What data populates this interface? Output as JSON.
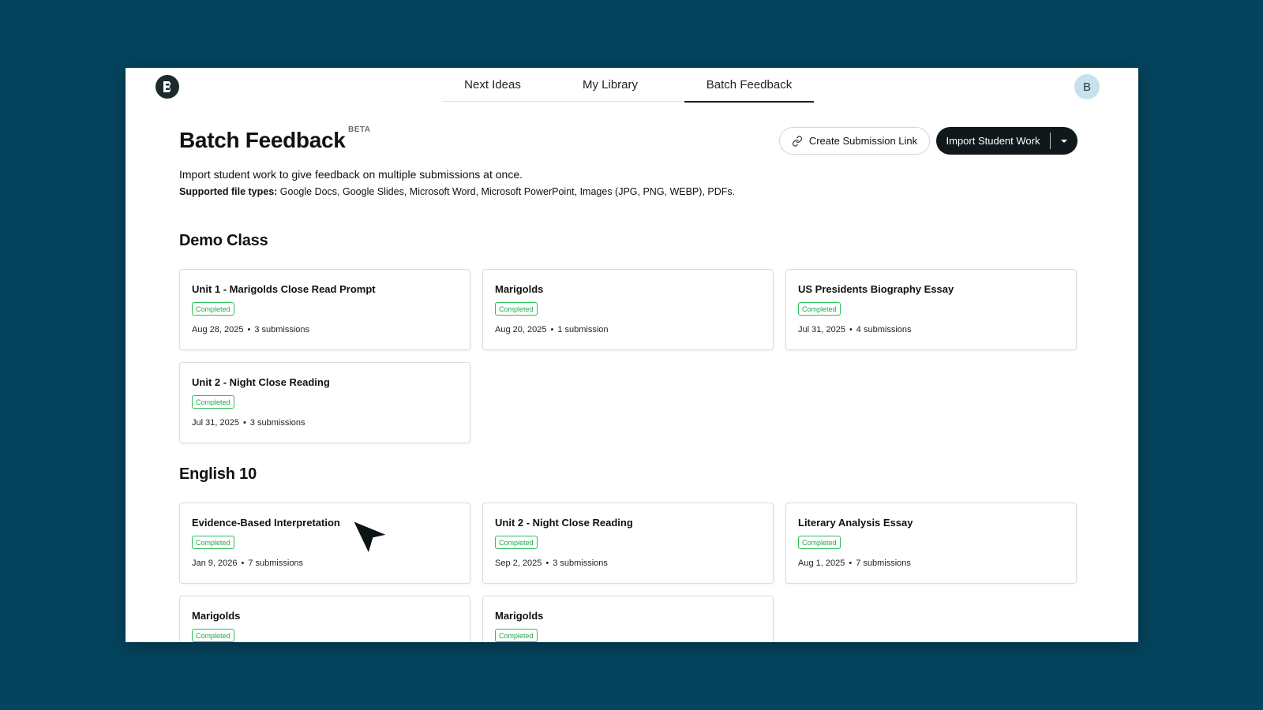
{
  "header": {
    "logo_letter": "B",
    "nav": [
      "Next Ideas",
      "My Library",
      "Batch Feedback"
    ],
    "active_tab": "Batch Feedback",
    "avatar_letter": "B"
  },
  "page": {
    "title": "Batch Feedback",
    "badge": "BETA",
    "create_link_label": "Create Submission Link",
    "import_label": "Import Student Work",
    "description": "Import student work to give feedback on multiple submissions at once.",
    "file_types_label": "Supported file types:",
    "file_types": " Google Docs, Google Slides, Microsoft Word, Microsoft PowerPoint, Images (JPG, PNG, WEBP), PDFs."
  },
  "sections": [
    {
      "title": "Demo Class",
      "cards": [
        {
          "title": "Unit 1 - Marigolds Close Read Prompt",
          "status": "Completed",
          "date": "Aug 28, 2025",
          "count": "3 submissions"
        },
        {
          "title": "Marigolds",
          "status": "Completed",
          "date": "Aug 20, 2025",
          "count": "1 submission"
        },
        {
          "title": "US Presidents Biography Essay",
          "status": "Completed",
          "date": "Jul 31, 2025",
          "count": "4 submissions"
        },
        {
          "title": "Unit 2 - Night Close Reading",
          "status": "Completed",
          "date": "Jul 31, 2025",
          "count": "3 submissions"
        }
      ]
    },
    {
      "title": "English 10",
      "cards": [
        {
          "title": "Evidence-Based Interpretation",
          "status": "Completed",
          "date": "Jan 9, 2026",
          "count": "7 submissions"
        },
        {
          "title": "Unit 2 - Night Close Reading",
          "status": "Completed",
          "date": "Sep 2, 2025",
          "count": "3 submissions"
        },
        {
          "title": "Literary Analysis Essay",
          "status": "Completed",
          "date": "Aug 1, 2025",
          "count": "7 submissions"
        },
        {
          "title": "Marigolds",
          "status": "Completed",
          "date": "",
          "count": ""
        },
        {
          "title": "Marigolds",
          "status": "Completed",
          "date": "",
          "count": ""
        }
      ]
    }
  ],
  "colors": {
    "background": "#05445e",
    "primary_button": "#10181c",
    "status_green": "#20a84d",
    "avatar_bg": "#c6e2ec"
  },
  "icons": [
    "logo-icon",
    "link-icon",
    "caret-down-icon",
    "cursor-arrow-icon"
  ]
}
